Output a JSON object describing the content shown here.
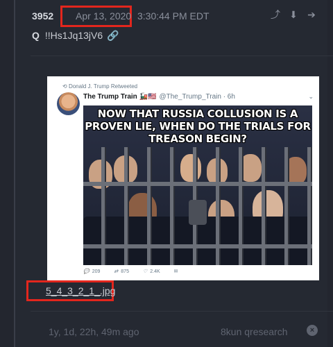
{
  "post": {
    "number": "3952",
    "date": "Apr 13, 2020",
    "time": "3:30:44 PM EDT",
    "icons": [
      "share-icon",
      "download-icon",
      "arrow-right-icon"
    ],
    "author": "Q",
    "tripcode": "!!Hs1Jq13jV6",
    "link_icon": "link-icon"
  },
  "tweet": {
    "retweeted_by": "Donald J. Trump Retweeted",
    "account_name": "The Trump Train",
    "handle": "@The_Trump_Train · 6h",
    "caption": "NOW THAT RUSSIA COLLUSION IS A PROVEN LIE, WHEN DO THE TRIALS FOR TREASON BEGIN?",
    "replies": "209",
    "retweets": "875",
    "likes": "2.4K"
  },
  "attachment": {
    "filename": "5_4_3_2_1_.jpg"
  },
  "footer": {
    "age": "1y, 1d, 22h, 49m ago",
    "board": "8kun qresearch"
  },
  "colors": {
    "highlight": "#e3261d",
    "link": "#4ea3e9",
    "background": "#23262f"
  }
}
